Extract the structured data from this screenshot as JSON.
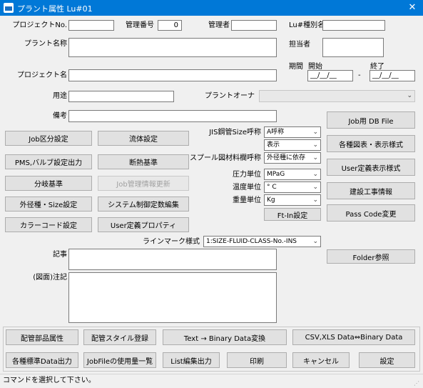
{
  "window": {
    "title": "プラント属性 Lu#01",
    "close_symbol": "✕"
  },
  "labels": {
    "project_no": "プロジェクトNo.",
    "mgmt_no": "管理番号",
    "manager": "管理者",
    "lu_type": "Lu#種別名",
    "plant_name": "プラント名称",
    "person_in_charge": "担当者",
    "project_name": "プロジェクト名",
    "period": "期間",
    "start": "開始",
    "end": "終了",
    "usage": "用途",
    "plant_owner": "プラントオーナ",
    "remarks": "備考",
    "jis_size": "JIS鋼管Size呼称",
    "spool_material": "スプール図材料欄呼称",
    "pressure_unit": "圧力単位",
    "temp_unit": "温度単位",
    "weight_unit": "重量単位",
    "line_mark": "ラインマーク様式",
    "article": "記事",
    "drawing_note": "(図面)注記"
  },
  "values": {
    "mgmt_no": "0",
    "date_placeholder": "__/__/__",
    "date_dash": "-"
  },
  "selects": {
    "plant_owner": "",
    "jis_size": "A呼称",
    "jis_size_sub": "表示",
    "spool_material": "外径種に依存",
    "pressure_unit": "MPaG",
    "temp_unit": "° C",
    "weight_unit": "Kg",
    "line_mark": "1:SIZE-FLUID-CLASS-No.-INS"
  },
  "buttons": {
    "job_class": "Job区分設定",
    "fluid": "流体設定",
    "pms_valve": "PMS,バルブ設定出力",
    "insulation": "断熱基準",
    "branch": "分岐基準",
    "job_mgmt_update": "Job管理情報更新",
    "od_size": "外径種・Size設定",
    "sys_control": "システム制御定数編集",
    "color_code": "カラーコード設定",
    "user_property": "User定義プロパティ",
    "ftin": "Ft-In設定",
    "job_db": "Job用 DB File",
    "drawing_style": "各種図表・表示様式",
    "user_display": "User定義表示様式",
    "construction": "建設工事情報",
    "passcode": "Pass Code変更",
    "folder": "Folder参照",
    "pipe_parts": "配管部品属性",
    "pipe_style": "配管スタイル登録",
    "text_bin": "Text → Binary Data変換",
    "csv_bin": "CSV,XLS Data⇔Binary Data",
    "std_data": "各種標準Data出力",
    "jobfile_usage": "JobFileの使用量一覧",
    "list_edit": "List編集出力",
    "print": "印刷",
    "cancel": "キャンセル",
    "settings": "設定"
  },
  "status": {
    "message": "コマンドを選択して下さい。"
  },
  "colors": {
    "titlebar": "#0078d7",
    "background": "#f0f0f0"
  }
}
